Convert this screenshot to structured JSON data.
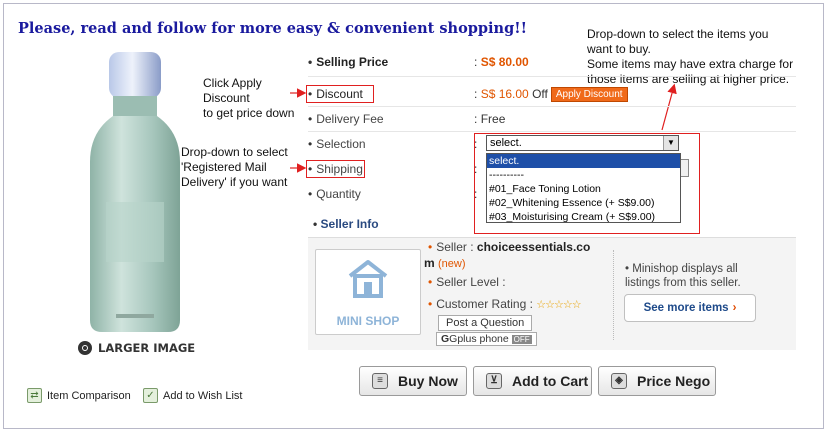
{
  "headline": "Please, read and follow for more easy & convenient shopping!!",
  "notes": {
    "apply_discount": [
      "Click Apply",
      "Discount",
      "to get price down"
    ],
    "shipping": [
      "Drop-down to select",
      "'Registered Mail",
      "Delivery' if you want"
    ],
    "dropdown": [
      "Drop-down to select the items you",
      "want to buy.",
      "Some items may have extra charge for",
      "those items are selling at higher price."
    ]
  },
  "product": {
    "larger_image": "LARGER IMAGE",
    "item_comparison": "Item Comparison",
    "add_to_wish_list": "Add to Wish List"
  },
  "fields": {
    "selling_price_label": "Selling Price",
    "selling_price_value": "S$ 80.00",
    "discount_label": "Discount",
    "discount_value": "S$ 16.00",
    "discount_off": "Off",
    "apply_discount_button": "Apply Discount",
    "delivery_fee_label": "Delivery Fee",
    "delivery_fee_value": "Free",
    "selection_label": "Selection",
    "shipping_label": "Shipping",
    "quantity_label": "Quantity",
    "colon": ":"
  },
  "selection": {
    "current": "select.",
    "options": [
      "select.",
      "----------",
      "#01_Face Toning Lotion",
      "#02_Whitening Essence (+ S$9.00)",
      "#03_Moisturising Cream (+ S$9.00)"
    ],
    "highlighted_index": 0
  },
  "seller": {
    "title": "Seller Info",
    "mini_shop_label": "MINI SHOP",
    "seller_label": "Seller :",
    "seller_name_line1": "choiceessentials.co",
    "seller_name_line2": "m",
    "new_tag": "(new)",
    "level_label": "Seller Level :",
    "rating_label": "Customer Rating :",
    "rating_stars": "☆☆☆☆☆",
    "post_question": "Post a Question",
    "gplus": "Gplus phone",
    "gplus_status": "OFF",
    "minishop_desc": [
      "Minishop displays all",
      "listings from this seller."
    ],
    "see_more": "See more items",
    "see_more_arrow": "›"
  },
  "actions": {
    "buy_now": "Buy Now",
    "add_to_cart": "Add to Cart",
    "price_nego": "Price Nego"
  },
  "colors": {
    "headline": "#1a1a9e",
    "accent_orange": "#e05500",
    "annotation_red": "#e02020",
    "selected_option": "#1e4fa8"
  }
}
